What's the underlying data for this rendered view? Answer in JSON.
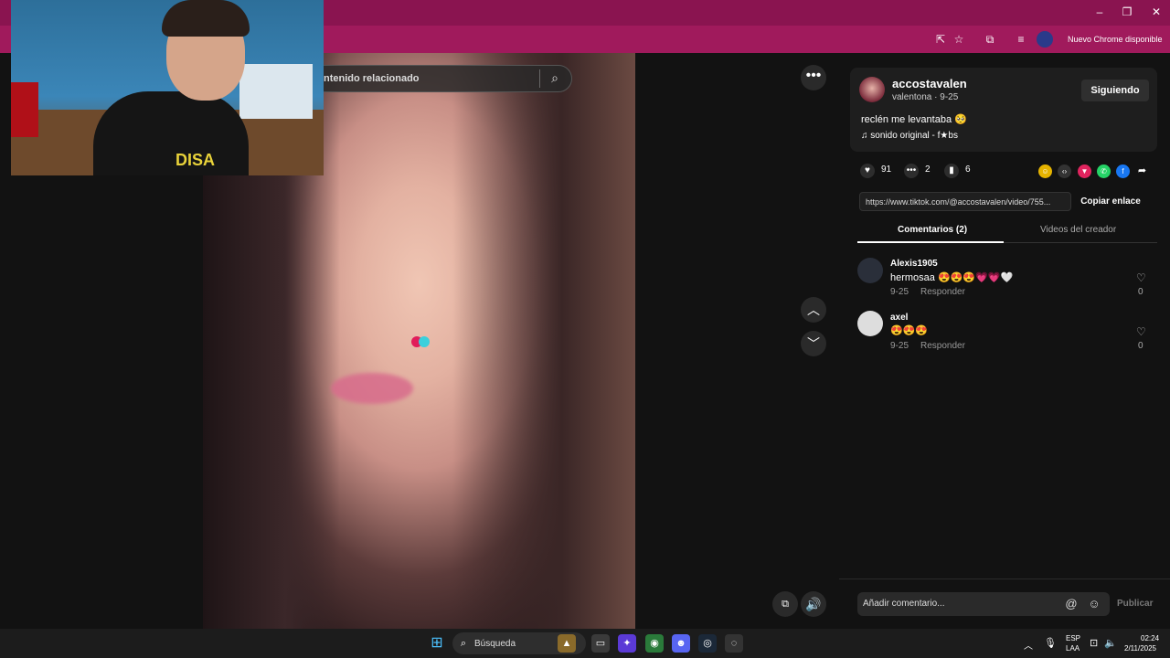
{
  "browser": {
    "update_label": "Nuevo Chrome disponible"
  },
  "video": {
    "search_placeholder": "ntenido relacionado"
  },
  "webcam": {
    "shirt_text": "DISA"
  },
  "post": {
    "username": "accostavalen",
    "subtitle": "valentona · 9-25",
    "follow_label": "Siguiendo",
    "caption": "reclén me levantaba 🥺",
    "sound": "sonido original - f★bs",
    "likes": "91",
    "comments": "2",
    "saves": "6",
    "link": "https://www.tiktok.com/@accostavalen/video/755...",
    "copy_label": "Copiar enlace"
  },
  "tabs": {
    "comments": "Comentarios (2)",
    "creator_videos": "Videos del creador"
  },
  "comments": [
    {
      "user": "Alexis1905",
      "text": "hermosaa 😍😍😍💗💗🤍",
      "date": "9-25",
      "reply": "Responder",
      "likes": "0"
    },
    {
      "user": "axel",
      "text": "😍😍😍",
      "date": "9-25",
      "reply": "Responder",
      "likes": "0"
    }
  ],
  "comment_box": {
    "placeholder": "Añadir comentario...",
    "publish": "Publicar"
  },
  "taskbar": {
    "search": "Búsqueda",
    "lang1": "ESP",
    "lang2": "LAA",
    "time": "02:24",
    "date": "2/11/2025"
  },
  "colors": {
    "accent": "#a01a5c",
    "background": "#121212"
  }
}
